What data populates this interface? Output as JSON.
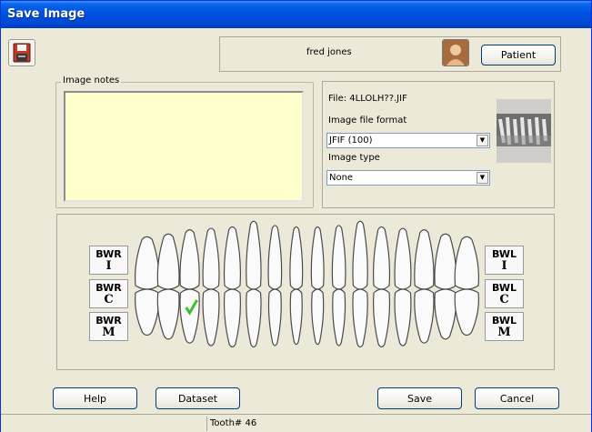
{
  "window": {
    "title": "Save Image"
  },
  "patient": {
    "name": "fred jones",
    "button_label": "Patient"
  },
  "notes": {
    "label": "Image notes",
    "value": ""
  },
  "file": {
    "file_text": "File: 4LLOLH??.JIF",
    "format_label": "Image file format",
    "format_value": "JFIF (100)",
    "type_label": "Image type",
    "type_value": "None"
  },
  "bitewings": {
    "right": [
      {
        "line1": "BWR",
        "line2": "I"
      },
      {
        "line1": "BWR",
        "line2": "C"
      },
      {
        "line1": "BWR",
        "line2": "M"
      }
    ],
    "left": [
      {
        "line1": "BWL",
        "line2": "I"
      },
      {
        "line1": "BWL",
        "line2": "C"
      },
      {
        "line1": "BWL",
        "line2": "M"
      }
    ]
  },
  "teeth": {
    "upper_count": 16,
    "lower_count": 16,
    "selected_lower_index": 2
  },
  "buttons": {
    "help": "Help",
    "dataset": "Dataset",
    "save": "Save",
    "cancel": "Cancel"
  },
  "status": {
    "tooth": "Tooth# 46"
  },
  "colors": {
    "notes_bg": "#ffffcc",
    "check": "#3fbf2f",
    "title_bar": "#0054e3"
  },
  "icons": {
    "save": "floppy-disk-icon",
    "patient": "patient-avatar-icon",
    "selected": "check-mark-icon",
    "combo": "dropdown-arrow-icon"
  }
}
